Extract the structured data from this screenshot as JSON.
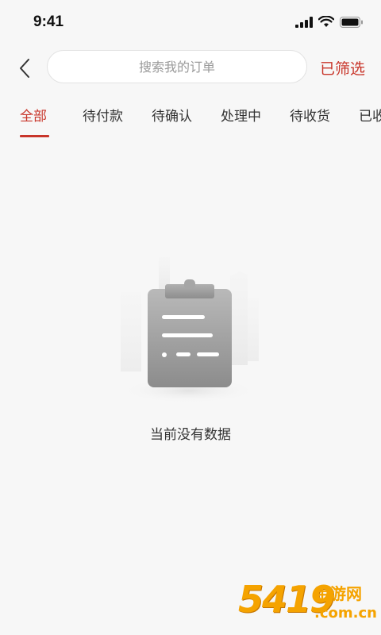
{
  "status_bar": {
    "time": "9:41"
  },
  "header": {
    "search_placeholder": "搜索我的订单",
    "filter_label": "已筛选"
  },
  "tabs": [
    {
      "label": "全部",
      "active": true
    },
    {
      "label": "待付款",
      "active": false
    },
    {
      "label": "待确认",
      "active": false
    },
    {
      "label": "处理中",
      "active": false
    },
    {
      "label": "待收货",
      "active": false
    },
    {
      "label": "已收",
      "active": false
    }
  ],
  "empty_state": {
    "message": "当前没有数据"
  },
  "watermark": {
    "number": "5419",
    "site_name": "手游网",
    "domain": ".com.cn"
  },
  "colors": {
    "accent": "#c8352a",
    "background": "#f7f7f7"
  }
}
